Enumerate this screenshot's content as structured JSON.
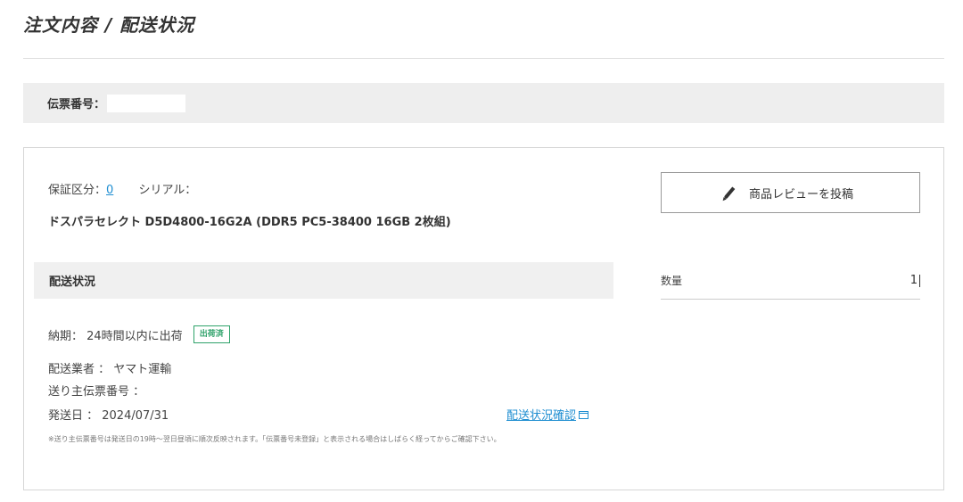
{
  "page": {
    "title": "注文内容 / 配送状況"
  },
  "slip": {
    "label": "伝票番号：",
    "value": ""
  },
  "item": {
    "warranty_label": "保証区分：",
    "warranty_value": "0",
    "serial_label": "シリアル：",
    "product_name": "ドスパラセレクト D5D4800-16G2A (DDR5 PC5-38400 16GB 2枚組)"
  },
  "shipping": {
    "section_title": "配送状況",
    "delivery_text": "納期： 24時間以内に出荷",
    "status_badge": "出荷済",
    "carrier_text": "配送業者 ： ヤマト運輸",
    "tracking_text": "送り主伝票番号 ：",
    "ship_date_text": "発送日 ： 2024/07/31",
    "track_link_label": "配送状況確認",
    "note": "※送り主伝票番号は発送日の19時〜翌日昼頃に順次反映されます。「伝票番号未登録」と表示される場合はしばらく経ってからご確認下さい。"
  },
  "review": {
    "button_label": "商品レビューを投稿"
  },
  "quantity": {
    "label": "数量",
    "value": "1"
  },
  "colors": {
    "link": "#1f8ed1",
    "badge": "#2fa26a"
  }
}
